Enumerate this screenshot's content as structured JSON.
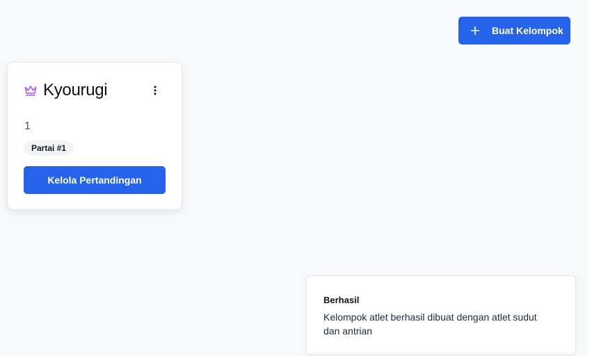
{
  "header": {
    "create_group_label": "Buat Kelompok"
  },
  "card": {
    "title": "Kyourugi",
    "count": "1",
    "badge": "Partai #1",
    "manage_label": "Kelola Pertandingan"
  },
  "toast": {
    "title": "Berhasil",
    "message": "Kelompok atlet berhasil dibuat dengan atlet sudut dan antrian"
  },
  "colors": {
    "primary": "#2563eb",
    "crown_accent": "#a855f7",
    "background": "#f8f9fb"
  },
  "icons": [
    "plus-icon",
    "crown-icon",
    "kebab-menu-icon"
  ]
}
